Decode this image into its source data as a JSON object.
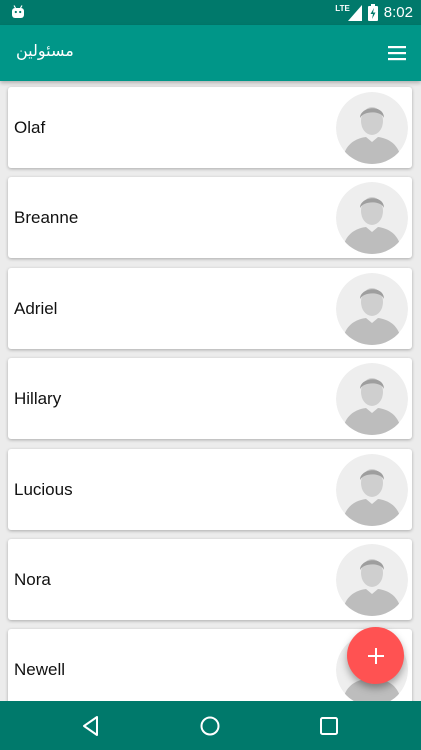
{
  "status_bar": {
    "network_label": "LTE",
    "time": "8:02"
  },
  "app_bar": {
    "title": "مسئولین",
    "menu_icon": "hamburger-menu-icon"
  },
  "contacts": [
    {
      "name": "Olaf",
      "avatar_icon": "default-avatar-icon"
    },
    {
      "name": "Breanne",
      "avatar_icon": "default-avatar-icon"
    },
    {
      "name": "Adriel",
      "avatar_icon": "default-avatar-icon"
    },
    {
      "name": "Hillary",
      "avatar_icon": "default-avatar-icon"
    },
    {
      "name": "Lucious",
      "avatar_icon": "default-avatar-icon"
    },
    {
      "name": "Nora",
      "avatar_icon": "default-avatar-icon"
    },
    {
      "name": "Newell",
      "avatar_icon": "default-avatar-icon"
    }
  ],
  "fab": {
    "icon": "add-icon"
  },
  "nav_bar": {
    "icons": [
      "back-icon",
      "home-icon",
      "recents-icon"
    ]
  },
  "colors": {
    "primary": "#009688",
    "primary_dark": "#00796b",
    "accent": "#ff5252",
    "background": "#ececec"
  }
}
